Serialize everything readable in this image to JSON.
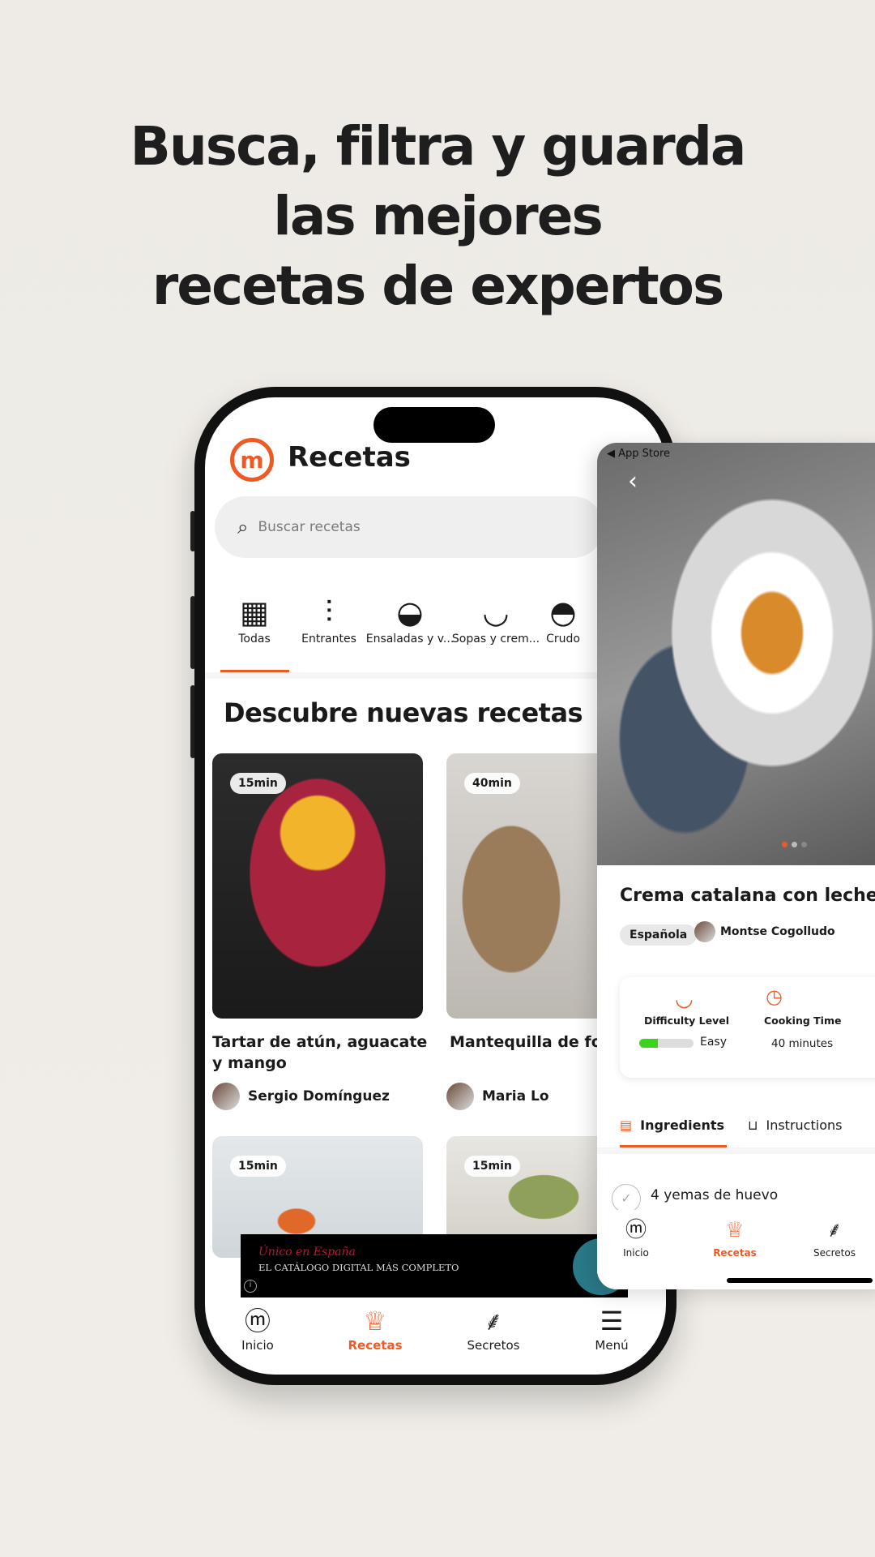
{
  "headline": {
    "line1": "Busca, filtra y guarda",
    "line2": "las mejores",
    "line3": "recetas de expertos"
  },
  "phone": {
    "title": "Recetas",
    "logo_letter": "m",
    "search": {
      "placeholder": "Buscar recetas"
    },
    "categories": [
      {
        "label": "Todas",
        "icon": "grid-icon",
        "active": true
      },
      {
        "label": "Entrantes",
        "icon": "skewer-icon"
      },
      {
        "label": "Ensaladas y v...",
        "icon": "salad-bowl-icon"
      },
      {
        "label": "Sopas y crem...",
        "icon": "soup-bowl-icon"
      },
      {
        "label": "Crudo",
        "icon": "fruit-bowl-icon"
      }
    ],
    "section_title": "Descubre nuevas recetas",
    "recipes": [
      {
        "time": "15min",
        "title": "Tartar de atún, aguacate y mango",
        "author": "Sergio Domínguez"
      },
      {
        "time": "40min",
        "title": "Mantequilla de foie",
        "author": "Maria Lo"
      },
      {
        "time": "15min"
      },
      {
        "time": "15min"
      }
    ],
    "ad": {
      "script_text": "Único en España",
      "main_text": "EL CATÁLOGO DIGITAL MÁS COMPLETO",
      "info": "i"
    },
    "nav": [
      {
        "label": "Inicio",
        "icon": "masterchef-logo-icon"
      },
      {
        "label": "Recetas",
        "icon": "chef-hat-icon",
        "active": true
      },
      {
        "label": "Secretos",
        "icon": "ladle-icon"
      },
      {
        "label": "Menú",
        "icon": "hamburger-menu-icon"
      }
    ]
  },
  "detail": {
    "back_app": "◀ App Store",
    "title": "Crema catalana con leche de",
    "tag": "Española",
    "author": "Montse Cogolludo",
    "difficulty": {
      "label": "Difficulty Level",
      "value": "Easy",
      "level": 1,
      "max": 3
    },
    "cooking": {
      "label": "Cooking Time",
      "value": "40 minutes"
    },
    "tabs": [
      {
        "label": "Ingredients",
        "active": true
      },
      {
        "label": "Instructions"
      }
    ],
    "ingredient": "4 yemas de huevo",
    "nav": [
      {
        "label": "Inicio"
      },
      {
        "label": "Recetas",
        "active": true
      },
      {
        "label": "Secretos"
      }
    ]
  },
  "colors": {
    "accent": "#ee5a24",
    "easy": "#3ad41a"
  }
}
